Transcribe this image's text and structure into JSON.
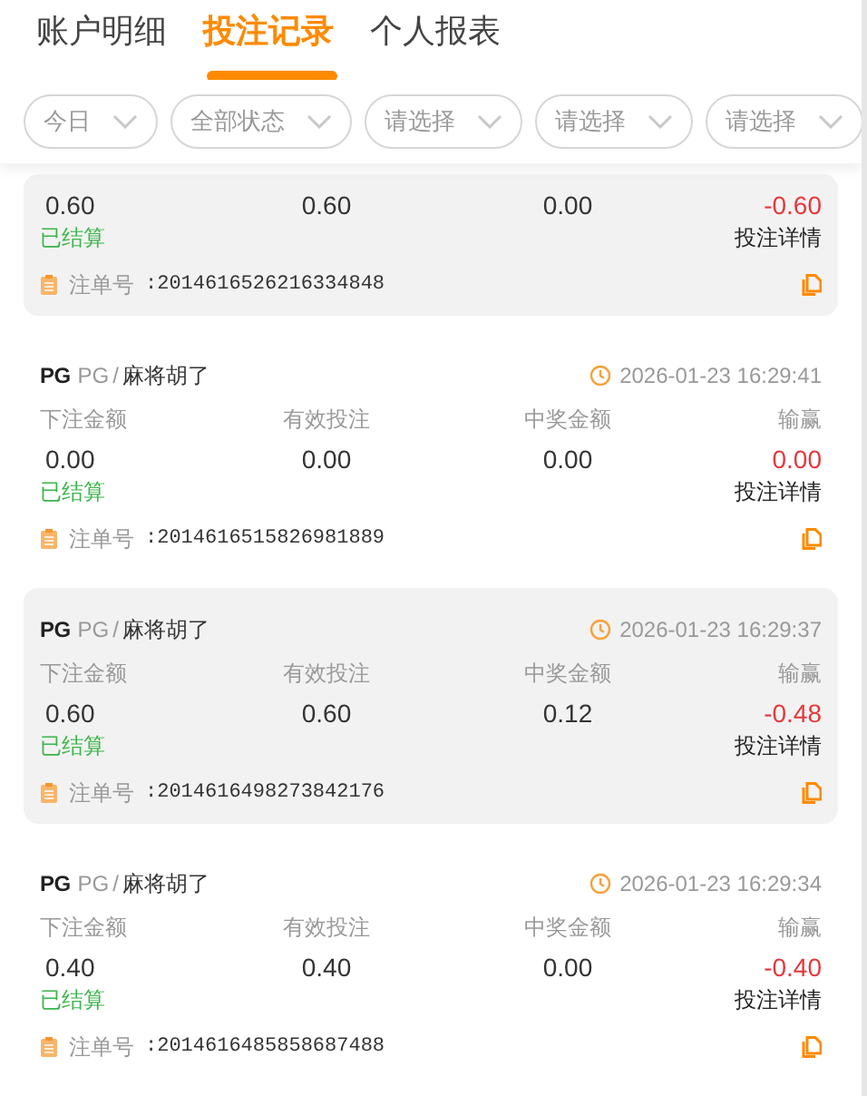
{
  "tabs": [
    {
      "label": "账户明细",
      "selected": false
    },
    {
      "label": "投注记录",
      "selected": true
    },
    {
      "label": "个人报表",
      "selected": false
    }
  ],
  "filters": [
    "今日",
    "全部状态",
    "请选择",
    "请选择",
    "请选择"
  ],
  "records": [
    {
      "shaded": true,
      "values": [
        "0.60",
        "0.60",
        "0.00",
        "-0.60"
      ],
      "loss": true,
      "status": "已结算",
      "detail": "投注详情",
      "order_label": "注单号",
      "order_no": ":2014616526216334848"
    },
    {
      "shaded": false,
      "logo": "PG",
      "provider": "PG",
      "separator": "/",
      "game": "麻将胡了",
      "time": "2026-01-23 16:29:41",
      "labels": [
        "下注金额",
        "有效投注",
        "中奖金额",
        "输赢"
      ],
      "values": [
        "0.00",
        "0.00",
        "0.00",
        "0.00"
      ],
      "loss": true,
      "status": "已结算",
      "detail": "投注详情",
      "order_label": "注单号",
      "order_no": ":2014616515826981889"
    },
    {
      "shaded": true,
      "logo": "PG",
      "provider": "PG",
      "separator": "/",
      "game": "麻将胡了",
      "time": "2026-01-23 16:29:37",
      "labels": [
        "下注金额",
        "有效投注",
        "中奖金额",
        "输赢"
      ],
      "values": [
        "0.60",
        "0.60",
        "0.12",
        "-0.48"
      ],
      "loss": true,
      "status": "已结算",
      "detail": "投注详情",
      "order_label": "注单号",
      "order_no": ":2014616498273842176"
    },
    {
      "shaded": false,
      "logo": "PG",
      "provider": "PG",
      "separator": "/",
      "game": "麻将胡了",
      "time": "2026-01-23 16:29:34",
      "labels": [
        "下注金额",
        "有效投注",
        "中奖金额",
        "输赢"
      ],
      "values": [
        "0.40",
        "0.40",
        "0.00",
        "-0.40"
      ],
      "loss": true,
      "status": "已结算",
      "detail": "投注详情",
      "order_label": "注单号",
      "order_no": ":2014616485858687488"
    }
  ]
}
